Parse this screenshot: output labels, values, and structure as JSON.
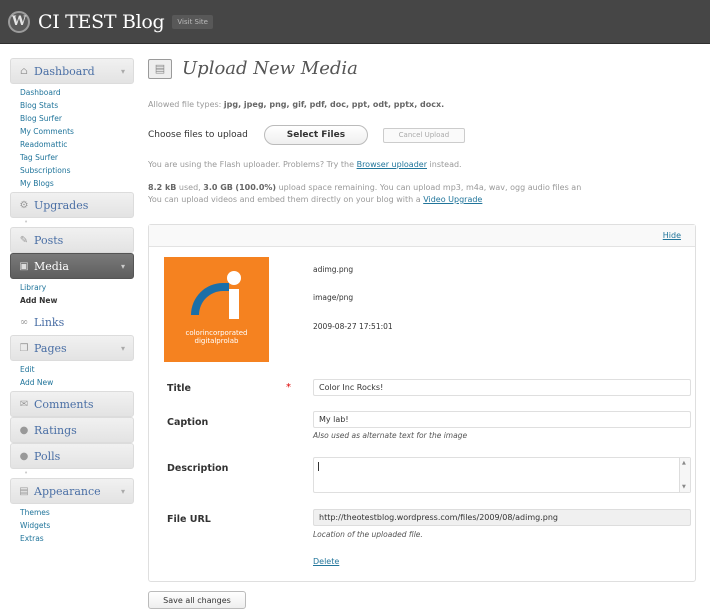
{
  "header": {
    "logo": "W",
    "site_title": "CI TEST Blog",
    "visit_site": "Visit Site"
  },
  "sidebar": {
    "dashboard": {
      "label": "Dashboard",
      "items": [
        "Dashboard",
        "Blog Stats",
        "Blog Surfer",
        "My Comments",
        "Readomattic",
        "Tag Surfer",
        "Subscriptions",
        "My Blogs"
      ]
    },
    "upgrades": "Upgrades",
    "posts": "Posts",
    "media": {
      "label": "Media",
      "items": [
        "Library",
        "Add New"
      ]
    },
    "links": "Links",
    "pages": {
      "label": "Pages",
      "items": [
        "Edit",
        "Add New"
      ]
    },
    "comments": "Comments",
    "ratings": "Ratings",
    "polls": "Polls",
    "appearance": {
      "label": "Appearance",
      "items": [
        "Themes",
        "Widgets",
        "Extras"
      ]
    }
  },
  "main": {
    "title": "Upload New Media",
    "allowed": {
      "prefix": "Allowed file types:",
      "types": "jpg, jpeg, png, gif, pdf, doc, ppt, odt, pptx, docx."
    },
    "choose_label": "Choose files to upload",
    "select_files": "Select Files",
    "cancel_upload": "Cancel Upload",
    "flash": {
      "text": "You are using the Flash uploader. Problems? Try the",
      "link": "Browser uploader",
      "suffix": "instead."
    },
    "space": {
      "used": "8.2 kB",
      "used_suffix": "used,",
      "remaining": "3.0 GB",
      "percent": "(100.0%)",
      "rest": "upload space remaining. You can upload mp3, m4a, wav, ogg audio files an",
      "line2": "You can upload videos and embed them directly on your blog with a",
      "line2_link": "Video Upgrade"
    },
    "item": {
      "hide": "Hide",
      "thumb_line1": "colorincorporated",
      "thumb_line2": "digitalprolab",
      "filename": "adimg.png",
      "mime": "image/png",
      "date": "2009-08-27 17:51:01",
      "fields": {
        "title_label": "Title",
        "required_mark": "*",
        "title_value": "Color Inc Rocks!",
        "caption_label": "Caption",
        "caption_value": "My lab!",
        "caption_help": "Also used as alternate text for the image",
        "description_label": "Description",
        "description_value": "",
        "file_url_label": "File URL",
        "file_url_value": "http://theotestblog.wordpress.com/files/2009/08/adimg.png",
        "file_url_help": "Location of the uploaded file."
      },
      "delete": "Delete"
    },
    "save_all": "Save all changes"
  }
}
